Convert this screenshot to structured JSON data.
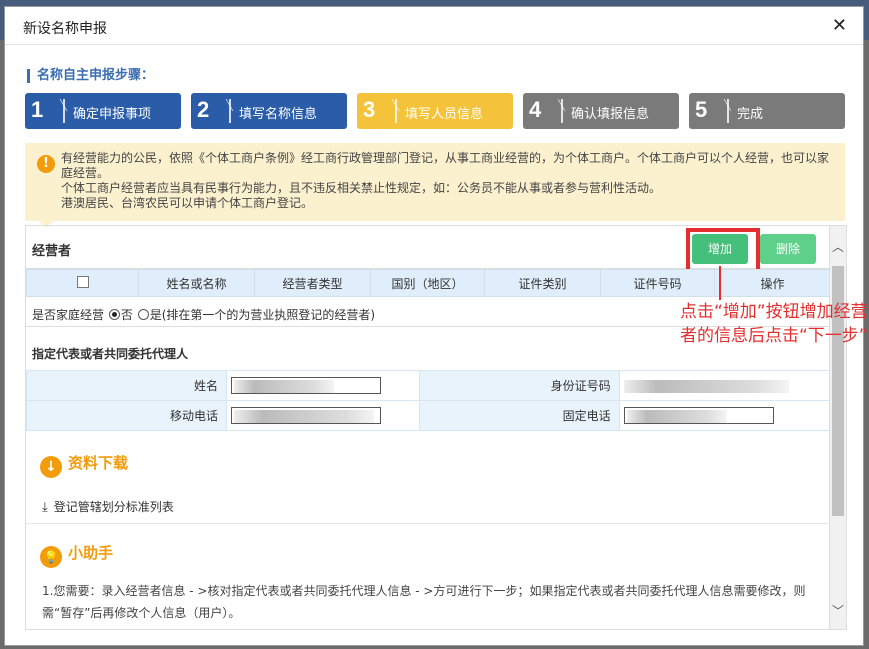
{
  "dialog": {
    "title": "新设名称申报"
  },
  "steps_label": "名称自主申报步骤：",
  "steps": [
    {
      "num": "1",
      "label": "确定申报事项"
    },
    {
      "num": "2",
      "label": "填写名称信息"
    },
    {
      "num": "3",
      "label": "填写人员信息"
    },
    {
      "num": "4",
      "label": "确认填报信息"
    },
    {
      "num": "5",
      "label": "完成"
    }
  ],
  "notice": {
    "line1": "有经营能力的公民，依照《个体工商户条例》经工商行政管理部门登记，从事工商业经营的，为个体工商户。个体工商户可以个人经营，也可以家庭经营。",
    "line2": "个体工商户经营者应当具有民事行为能力，且不违反相关禁止性规定，如：公务员不能从事或者参与营利性活动。",
    "line3": "港澳居民、台湾农民可以申请个体工商户登记。"
  },
  "operators": {
    "title": "经营者",
    "add_label": "增加",
    "delete_label": "删除",
    "columns": [
      "姓名或名称",
      "经营者类型",
      "国别（地区）",
      "证件类别",
      "证件号码",
      "操作"
    ],
    "family_prefix": "是否家庭经营",
    "opt_no": "否",
    "opt_yes": "是(排在第一个的为营业执照登记的经营者)"
  },
  "agent": {
    "title": "指定代表或者共同委托代理人",
    "name_label": "姓名",
    "id_label": "身份证号码",
    "mobile_label": "移动电话",
    "phone_label": "固定电话"
  },
  "downloads": {
    "title": "资料下载",
    "link": "登记管辖划分标准列表"
  },
  "helper": {
    "title": "小助手",
    "text": "1.您需要：录入经营者信息 - >核对指定代表或者共同委托代理人信息 - >方可进行下一步；如果指定代表或者共同委托代理人信息需要修改，则需“暂存”后再修改个人信息（用户）。"
  },
  "annotation": "点击“增加”按钮增加经营者的信息后点击“下一步”"
}
